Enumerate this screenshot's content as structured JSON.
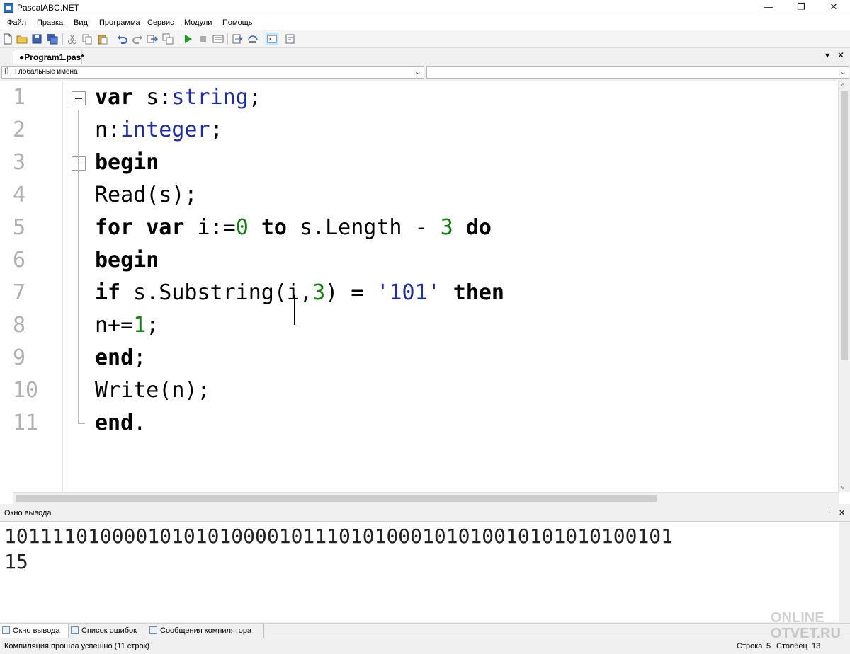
{
  "window": {
    "title": "PascalABC.NET",
    "minimize": "—",
    "maximize": "❐",
    "close": "✕"
  },
  "menu": [
    "Файл",
    "Правка",
    "Вид",
    "Программа",
    "Сервис",
    "Модули",
    "Помощь"
  ],
  "tabs": {
    "active": "●Program1.pas*",
    "dropdown": "▾",
    "close": "✕"
  },
  "combos": {
    "scope": "Глобальные имена",
    "member": ""
  },
  "editor": {
    "line_numbers": [
      "1",
      "2",
      "3",
      "4",
      "5",
      "6",
      "7",
      "8",
      "9",
      "10",
      "11"
    ],
    "cursor": {
      "line": 5,
      "column": 13
    },
    "lines": [
      [
        {
          "t": "var",
          "c": "kw"
        },
        {
          "t": " s:",
          "c": ""
        },
        {
          "t": "string",
          "c": "ty"
        },
        {
          "t": ";",
          "c": ""
        }
      ],
      [
        {
          "t": "n:",
          "c": ""
        },
        {
          "t": "integer",
          "c": "ty"
        },
        {
          "t": ";",
          "c": ""
        }
      ],
      [
        {
          "t": "begin",
          "c": "kw"
        }
      ],
      [
        {
          "t": "Read(s);",
          "c": ""
        }
      ],
      [
        {
          "t": "for",
          "c": "kw"
        },
        {
          "t": " ",
          "c": ""
        },
        {
          "t": "var",
          "c": "kw"
        },
        {
          "t": " i:=",
          "c": ""
        },
        {
          "t": "0",
          "c": "num"
        },
        {
          "t": " ",
          "c": ""
        },
        {
          "t": "to",
          "c": "kw"
        },
        {
          "t": " s.Length - ",
          "c": ""
        },
        {
          "t": "3",
          "c": "num"
        },
        {
          "t": " ",
          "c": ""
        },
        {
          "t": "do",
          "c": "kw"
        }
      ],
      [
        {
          "t": "begin",
          "c": "kw"
        }
      ],
      [
        {
          "t": "if",
          "c": "kw"
        },
        {
          "t": " s.Substring(i,",
          "c": ""
        },
        {
          "t": "3",
          "c": "num"
        },
        {
          "t": ") = ",
          "c": ""
        },
        {
          "t": "'101'",
          "c": "str"
        },
        {
          "t": " ",
          "c": ""
        },
        {
          "t": "then",
          "c": "kw"
        }
      ],
      [
        {
          "t": "n+=",
          "c": ""
        },
        {
          "t": "1",
          "c": "num"
        },
        {
          "t": ";",
          "c": ""
        }
      ],
      [
        {
          "t": "end",
          "c": "kw"
        },
        {
          "t": ";",
          "c": ""
        }
      ],
      [
        {
          "t": "Write(n);",
          "c": ""
        }
      ],
      [
        {
          "t": "end",
          "c": "kw"
        },
        {
          "t": ".",
          "c": ""
        }
      ]
    ]
  },
  "output": {
    "title": "Окно вывода",
    "pin": "📌",
    "close": "✕",
    "lines": [
      "10111101000010101010000101110101000101010010101010100101",
      "15"
    ]
  },
  "bottom_tabs": [
    "Окно вывода",
    "Список ошибок",
    "Сообщения компилятора"
  ],
  "status": {
    "message": "Компиляция прошла успешно (11 строк)",
    "row_label": "Строка",
    "row_value": "5",
    "col_label": "Столбец",
    "col_value": "13"
  },
  "watermark": "ONLINE OTVET.RU",
  "colors": {
    "keyword": "#000000",
    "type": "#1d2bb0",
    "number": "#147d14",
    "string": "#1d2bb0",
    "line_number": "#b0b0b0"
  }
}
